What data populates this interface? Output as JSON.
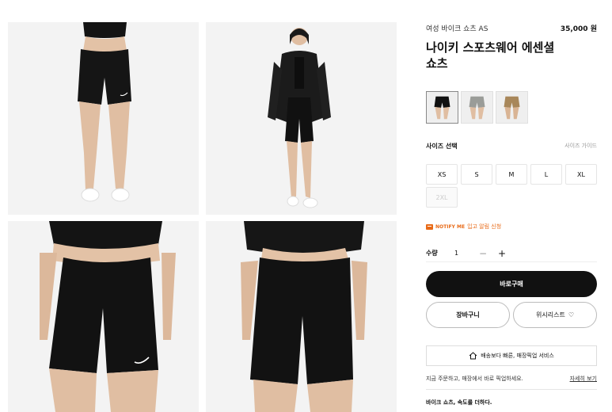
{
  "product": {
    "subtitle": "여성 바이크 쇼츠 AS",
    "price": "35,000 원",
    "title": "나이키 스포츠웨어 에센셜 쇼츠"
  },
  "gallery": {
    "images": [
      "front-view-shorts",
      "model-with-jacket",
      "closeup-front",
      "closeup-back"
    ]
  },
  "colors": {
    "swatches": [
      "black",
      "grey",
      "khaki"
    ],
    "selected": "black"
  },
  "size": {
    "label": "사이즈 선택",
    "guide": "사이즈 가이드",
    "options": [
      "XS",
      "S",
      "M",
      "L",
      "XL",
      "2XL"
    ],
    "disabled": [
      "2XL"
    ]
  },
  "notify": {
    "badge": "NOTIFY ME",
    "text": "입고 알림 신청"
  },
  "quantity": {
    "label": "수량",
    "value": "1",
    "minus": "−",
    "plus": "+"
  },
  "actions": {
    "buy": "바로구매",
    "cart": "장바구니",
    "wishlist": "위시리스트",
    "heart": "♡"
  },
  "delivery": {
    "box_text": "배송보다 빠른, 매장픽업 서비스",
    "note": "지금 주문하고, 매장에서 바로 픽업하세요.",
    "detail_link": "자세히 보기"
  },
  "description": {
    "headline": "바이크 쇼츠, 속도를 더하다."
  },
  "theme": {
    "accent": "#111111",
    "notify": "#e86a17",
    "photo_bg": "#f2f2f2"
  }
}
